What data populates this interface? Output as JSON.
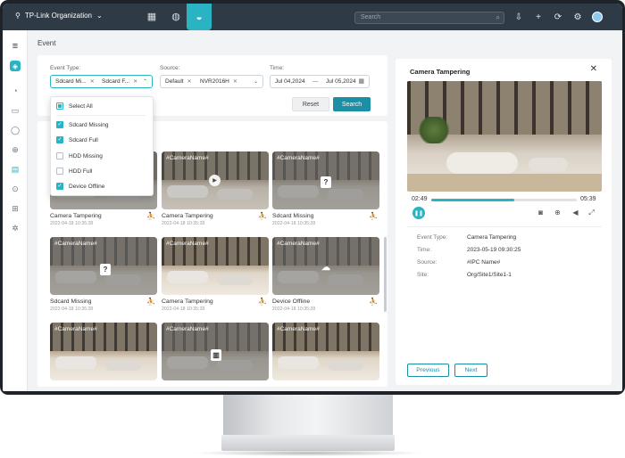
{
  "header": {
    "org_name": "TP-Link Organization",
    "search_placeholder": "Search"
  },
  "page": {
    "title": "Event"
  },
  "filters": {
    "event_type_label": "Event Type:",
    "event_type_tags": [
      "Sdcard Mi...",
      "Sdcard F..."
    ],
    "source_label": "Source:",
    "source_tags": [
      "Default",
      "NVR2016H"
    ],
    "time_label": "Time:",
    "time_start": "Jul 04,2024",
    "time_end": "Jul 05,2024",
    "reset_label": "Reset",
    "search_label": "Search"
  },
  "dropdown": {
    "options": [
      {
        "label": "Select All",
        "state": "partial"
      },
      {
        "label": "Sdcard Missing",
        "state": "checked"
      },
      {
        "label": "Sdcard Full",
        "state": "checked"
      },
      {
        "label": "HDD Missing",
        "state": "unchecked"
      },
      {
        "label": "HDD Full",
        "state": "unchecked"
      },
      {
        "label": "Device Offline",
        "state": "checked"
      }
    ]
  },
  "events": [
    {
      "camera": "",
      "title": "Camera Tampering",
      "time": "2022-04-18 10:35:28"
    },
    {
      "camera": "#CameraName#",
      "title": "Camera Tampering",
      "time": "2022-04-18 10:35:28"
    },
    {
      "camera": "#CameraName#",
      "title": "Sdcard Missing",
      "time": "2022-04-18 10:35:28"
    },
    {
      "camera": "#CameraName#",
      "title": "Sdcard Missing",
      "time": "2022-04-18 10:35:28"
    },
    {
      "camera": "#CameraName#",
      "title": "Camera Tampering",
      "time": "2022-04-18 10:35:28"
    },
    {
      "camera": "#CameraName#",
      "title": "Device Offline",
      "time": "2022-04-18 10:35:28"
    },
    {
      "camera": "#CameraName#",
      "title": "",
      "time": ""
    },
    {
      "camera": "#CameraName#",
      "title": "",
      "time": ""
    },
    {
      "camera": "#CameraName#",
      "title": "",
      "time": ""
    }
  ],
  "detail": {
    "title": "Camera Tampering",
    "time_current": "02:49",
    "time_total": "05:39",
    "progress": 0.57,
    "fields": [
      {
        "label": "Event Type:",
        "value": "Camera Tampering"
      },
      {
        "label": "Time:",
        "value": "2023-05-19  09:30:25"
      },
      {
        "label": "Source:",
        "value": "#IPC Name#"
      },
      {
        "label": "Site:",
        "value": "Org/Site1/Site1-1"
      }
    ],
    "prev_label": "Previous",
    "next_label": "Next"
  },
  "colors": {
    "accent": "#2ab3c3",
    "primary_button": "#1b8fa3",
    "alert": "#e0393e",
    "topbar": "#2e3a46"
  }
}
